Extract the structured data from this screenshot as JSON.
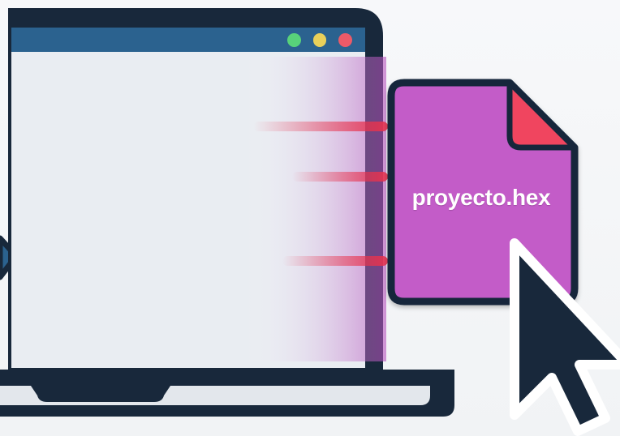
{
  "file": {
    "name": "proyecto.hex",
    "icon": "hex-file-icon",
    "color": "#c35cc8",
    "corner_color": "#f0445e"
  },
  "window": {
    "controls": [
      {
        "name": "minimize-dot",
        "color": "#58d27a"
      },
      {
        "name": "maximize-dot",
        "color": "#e9d05a"
      },
      {
        "name": "close-dot",
        "color": "#ec5a68"
      }
    ]
  },
  "colors": {
    "frame": "#18283b",
    "titlebar": "#2b628f",
    "screen": "#e9edf2",
    "motion": "#e8334d"
  },
  "icons": {
    "laptop": "laptop-icon",
    "cursor": "mouse-pointer-icon",
    "arrow": "arrow-right-icon"
  }
}
